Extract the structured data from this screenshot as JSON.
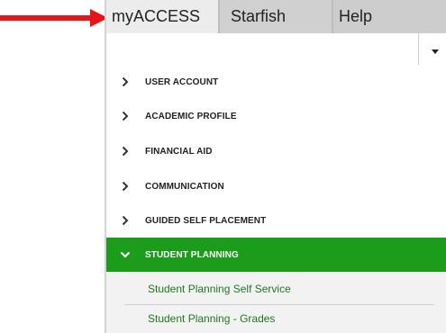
{
  "tabs": [
    {
      "label": "myACCESS",
      "active": true
    },
    {
      "label": "Starfish",
      "active": false
    },
    {
      "label": "Help",
      "active": false
    }
  ],
  "menu": {
    "items": [
      {
        "label": "USER ACCOUNT",
        "icon": "chevron-right-icon",
        "expanded": false
      },
      {
        "label": "ACADEMIC PROFILE",
        "icon": "chevron-right-icon",
        "expanded": false
      },
      {
        "label": "FINANCIAL AID",
        "icon": "chevron-right-icon",
        "expanded": false
      },
      {
        "label": "COMMUNICATION",
        "icon": "chevron-right-icon",
        "expanded": false
      },
      {
        "label": "GUIDED SELF PLACEMENT",
        "icon": "chevron-right-icon",
        "expanded": false
      },
      {
        "label": "STUDENT PLANNING",
        "icon": "chevron-down-icon",
        "expanded": true
      }
    ],
    "subitems": [
      {
        "label": "Student Planning Self Service"
      },
      {
        "label": "Student Planning - Grades"
      }
    ]
  },
  "colors": {
    "accent": "#1b9c1b",
    "subitem_text": "#1d7a1d",
    "annotation_arrow": "#e8141b"
  }
}
